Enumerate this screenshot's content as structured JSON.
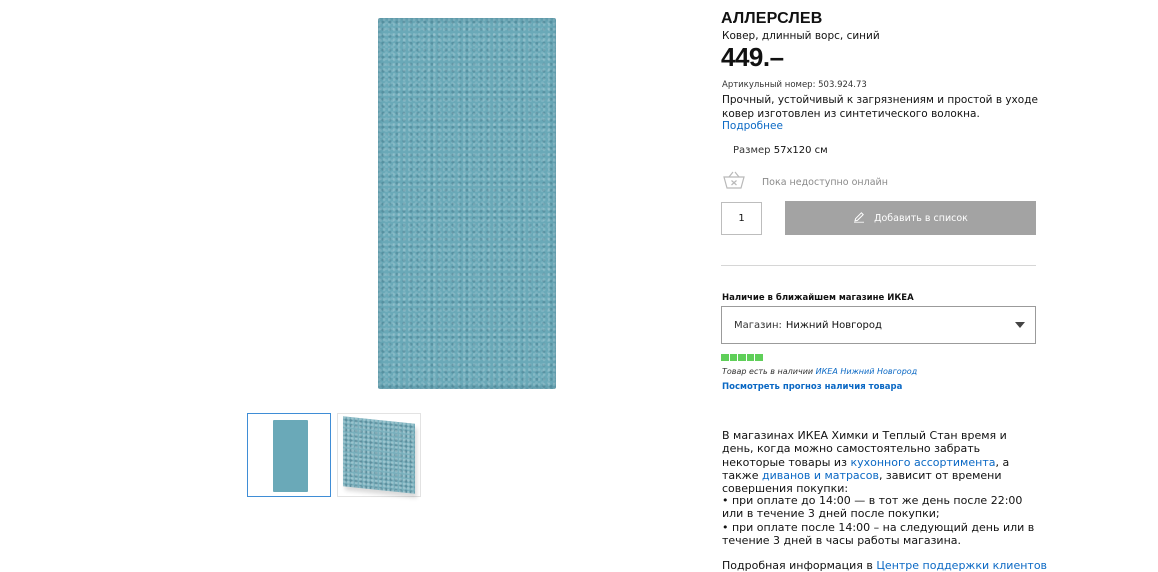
{
  "product": {
    "name": "АЛЛЕРСЛЕВ",
    "subtitle": "Ковер, длинный ворс, синий",
    "price": "449.–",
    "article": "Артикульный номер: 503.924.73",
    "description": "Прочный, устойчивый к загрязнениям и простой в уходе ковер изготовлен из синтетического волокна.",
    "more_link": "Подробнее",
    "size_label": "Размер",
    "size_value": "57x120 см",
    "rug_color": "#6aa9b8"
  },
  "purchase": {
    "unavailable_text": "Пока недоступно онлайн",
    "quantity": "1",
    "add_to_list_label": "Добавить в список",
    "button_color": "#a3a3a3"
  },
  "availability": {
    "heading": "Наличие в ближайшем магазине ИКЕА",
    "store_label": "Магазин:",
    "store_value": "Нижний Новгород",
    "stock_text": "Товар есть в наличии",
    "stock_store_link": "ИКЕА Нижний Новгород",
    "forecast_link": "Посмотреть прогноз наличия товара",
    "stock_color": "#5fcf59"
  },
  "info": {
    "p1_a": "В магазинах ИКЕА Химки и Теплый Стан время и день, когда можно самостоятельно забрать некоторые товары из ",
    "p1_link1": "кухонного ассортимента",
    "p1_b": ", а также ",
    "p1_link2": "диванов и матрасов",
    "p1_c": ", зависит от времени совершения покупки:",
    "bullet1": "• при оплате до 14:00 — в тот же день после 22:00 или в течение 3 дней после покупки;",
    "bullet2": "• при оплате после 14:00 – на следующий день или в течение 3 дней в часы работы магазина.",
    "support_text": "Подробная информация в ",
    "support_link": "Центре поддержки клиентов"
  },
  "icons": {
    "cart": "cart-icon",
    "pencil": "pencil-icon",
    "caret": "chevron-down-icon"
  },
  "colors": {
    "link": "#0a68c4",
    "accent_border": "#3f8dd6"
  }
}
